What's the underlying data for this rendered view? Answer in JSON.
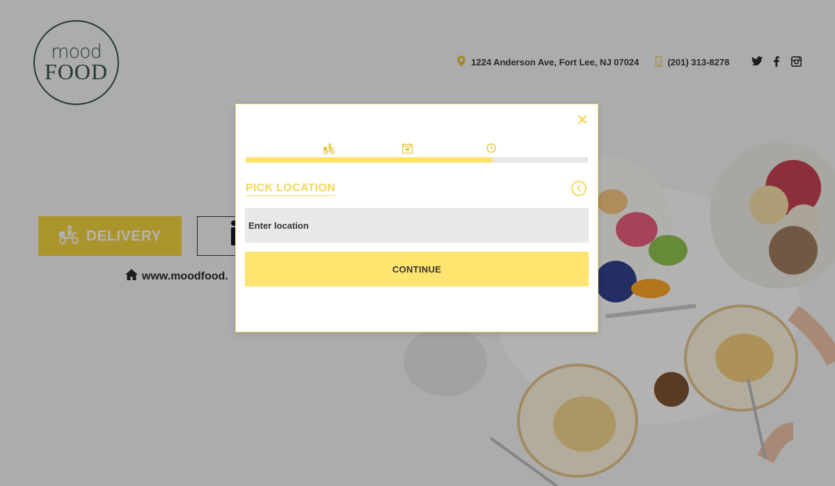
{
  "brand": {
    "logo_line1": "mood",
    "logo_line2": "FOOD"
  },
  "header": {
    "address": "1224 Anderson Ave, Fort Lee, NJ 07024",
    "phone": "(201) 313-8278",
    "social": [
      "twitter-icon",
      "facebook-icon",
      "instagram-icon"
    ]
  },
  "hero": {
    "delivery_label": "DELIVERY",
    "website": "www.moodfood."
  },
  "modal": {
    "close_label": "×",
    "steps": [
      "delivery-scooter-icon",
      "calendar-icon",
      "clock-icon"
    ],
    "progress_percent": 72,
    "title": "PICK LOCATION",
    "location_placeholder": "Enter location",
    "continue_label": "CONTINUE"
  },
  "colors": {
    "accent": "#ffe36a",
    "accent_text": "#f4d75a",
    "brand_green": "#2f4a3f"
  }
}
